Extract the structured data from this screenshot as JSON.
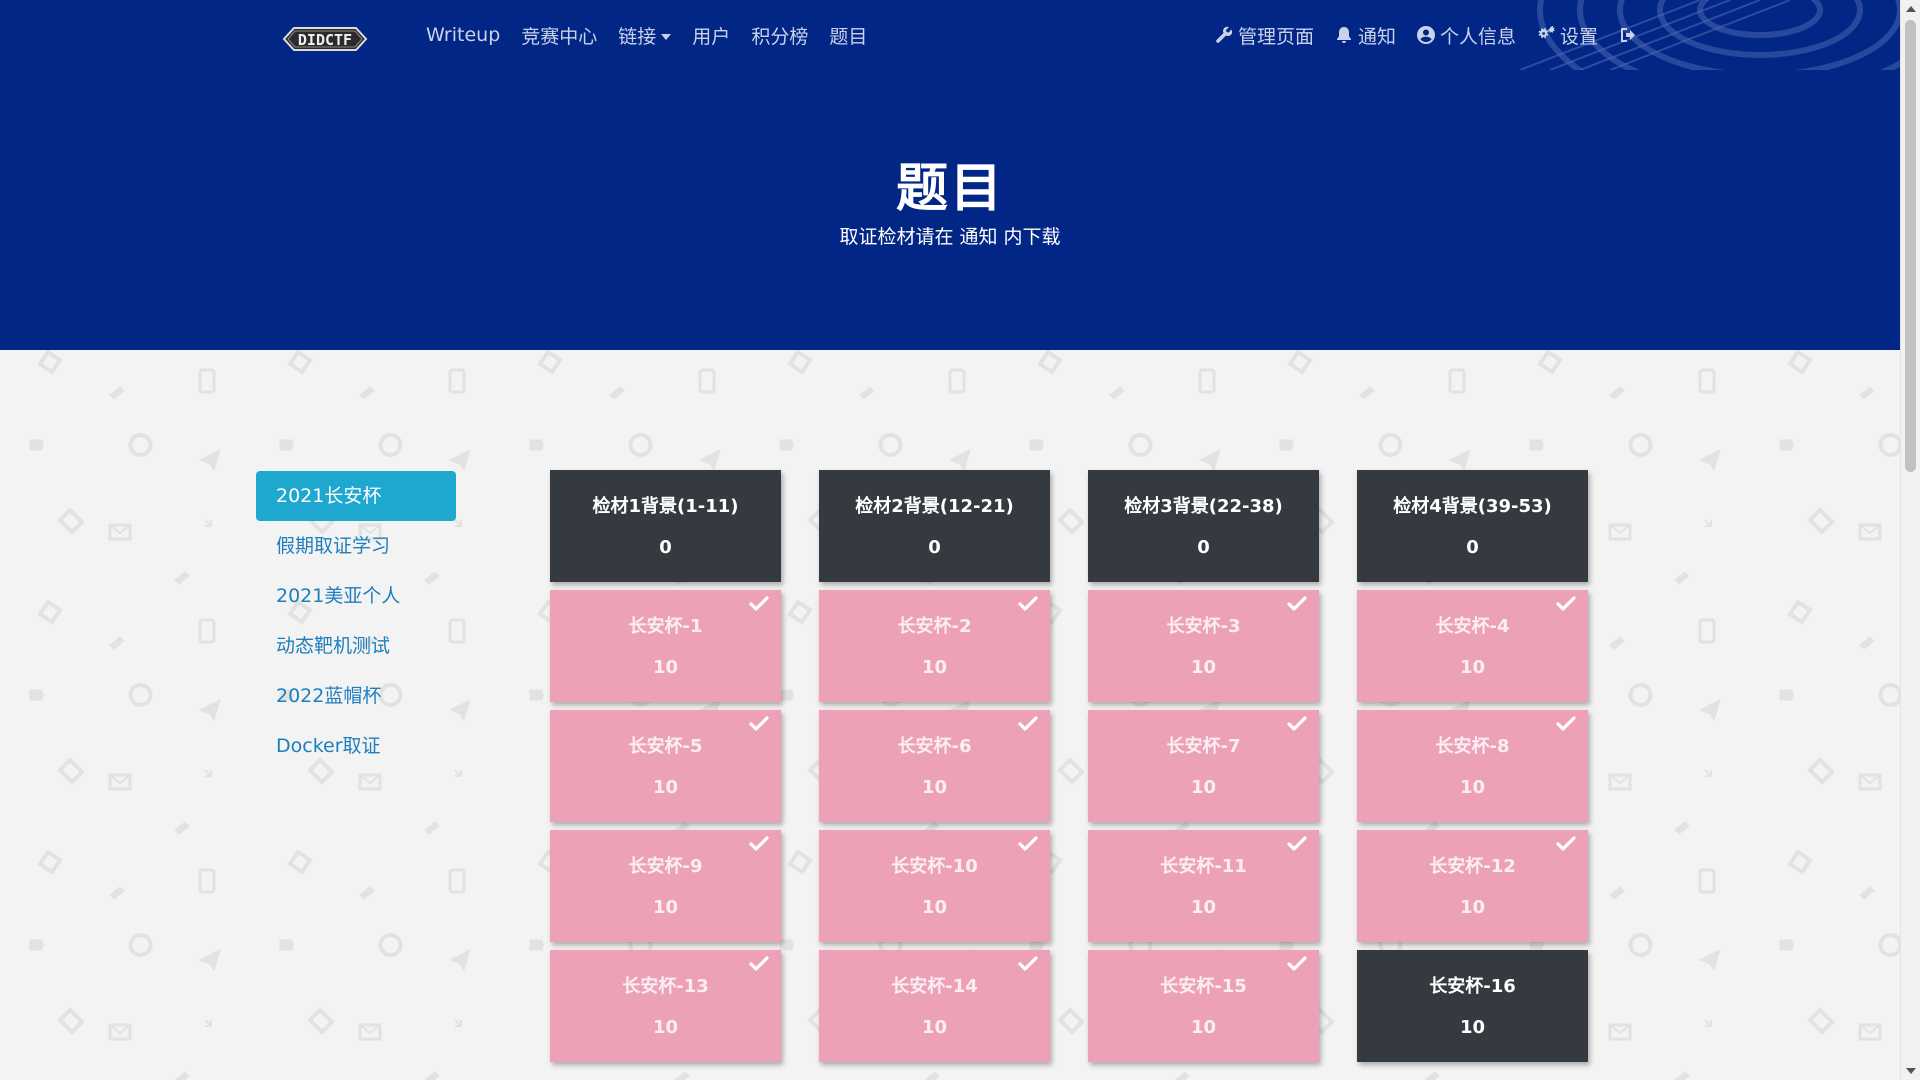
{
  "brand": {
    "logo_text": "DIDCTF"
  },
  "nav": {
    "left": [
      "Writeup",
      "竞赛中心",
      "链接",
      "用户",
      "积分榜",
      "题目"
    ],
    "right": [
      {
        "label": "管理页面",
        "icon": "wrench-icon"
      },
      {
        "label": "通知",
        "icon": "bell-icon"
      },
      {
        "label": "个人信息",
        "icon": "user-circle-icon"
      },
      {
        "label": "设置",
        "icon": "gears-icon"
      },
      {
        "label": "",
        "icon": "sign-out-icon"
      }
    ]
  },
  "hero": {
    "title": "题目",
    "subtitle": "取证检材请在 通知 内下载"
  },
  "categories": {
    "items": [
      "2021长安杯",
      "假期取证学习",
      "2021美亚个人",
      "动态靶机测试",
      "2022蓝帽杯",
      "Docker取证"
    ],
    "active_index": 0
  },
  "challenges": [
    {
      "name": "检材1背景(1-11)",
      "value": "0",
      "solved": false
    },
    {
      "name": "检材2背景(12-21)",
      "value": "0",
      "solved": false
    },
    {
      "name": "检材3背景(22-38)",
      "value": "0",
      "solved": false
    },
    {
      "name": "检材4背景(39-53)",
      "value": "0",
      "solved": false
    },
    {
      "name": "长安杯-1",
      "value": "10",
      "solved": true
    },
    {
      "name": "长安杯-2",
      "value": "10",
      "solved": true
    },
    {
      "name": "长安杯-3",
      "value": "10",
      "solved": true
    },
    {
      "name": "长安杯-4",
      "value": "10",
      "solved": true
    },
    {
      "name": "长安杯-5",
      "value": "10",
      "solved": true
    },
    {
      "name": "长安杯-6",
      "value": "10",
      "solved": true
    },
    {
      "name": "长安杯-7",
      "value": "10",
      "solved": true
    },
    {
      "name": "长安杯-8",
      "value": "10",
      "solved": true
    },
    {
      "name": "长安杯-9",
      "value": "10",
      "solved": true
    },
    {
      "name": "长安杯-10",
      "value": "10",
      "solved": true
    },
    {
      "name": "长安杯-11",
      "value": "10",
      "solved": true
    },
    {
      "name": "长安杯-12",
      "value": "10",
      "solved": true
    },
    {
      "name": "长安杯-13",
      "value": "10",
      "solved": true
    },
    {
      "name": "长安杯-14",
      "value": "10",
      "solved": true
    },
    {
      "name": "长安杯-15",
      "value": "10",
      "solved": true
    },
    {
      "name": "长安杯-16",
      "value": "10",
      "solved": false
    }
  ],
  "colors": {
    "navbar": "#012686",
    "card_unsolved": "#353a40",
    "card_solved": "#eda1b7",
    "sidebar_active": "#1ea8cf",
    "sidebar_link": "#1f7ebd"
  }
}
